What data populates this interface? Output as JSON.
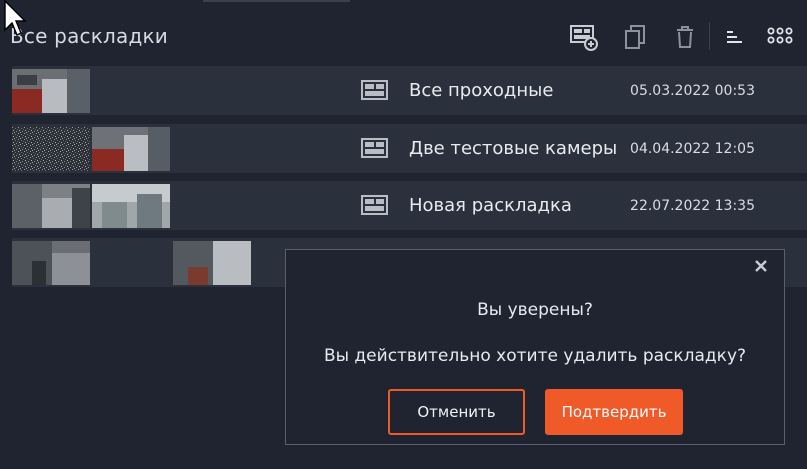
{
  "header": {
    "title": "Все раскладки",
    "icons": [
      "add-layout-icon",
      "copy-icon",
      "trash-icon",
      "sort-icon",
      "grid-view-icon"
    ]
  },
  "layouts": [
    {
      "name": "Все проходные",
      "date": "05.03.2022 00:53"
    },
    {
      "name": "Две тестовые камеры",
      "date": "04.04.2022 12:05"
    },
    {
      "name": "Новая раскладка",
      "date": "22.07.2022 13:35"
    },
    {
      "name": "",
      "date": ""
    }
  ],
  "dialog": {
    "title": "Вы уверены?",
    "message": "Вы действительно хотите удалить раскладку?",
    "cancel_label": "Отменить",
    "confirm_label": "Подтвердить"
  },
  "colors": {
    "background": "#1f2430",
    "row": "#2a303c",
    "accent": "#f05a28"
  }
}
